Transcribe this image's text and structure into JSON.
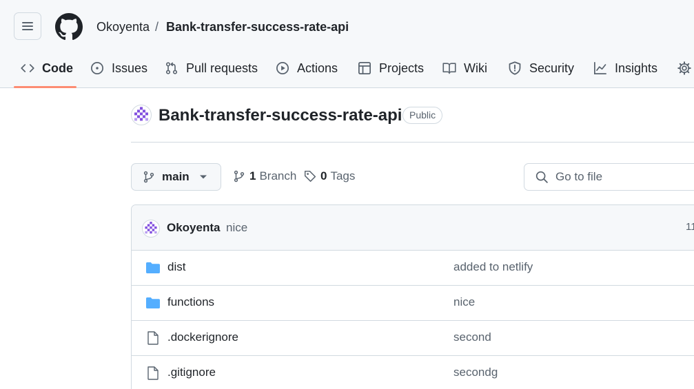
{
  "header": {
    "owner": "Okoyenta",
    "separator": "/",
    "repo": "Bank-transfer-success-rate-api"
  },
  "tabs": [
    {
      "label": "Code",
      "icon": "code-icon",
      "active": true
    },
    {
      "label": "Issues",
      "icon": "issue-icon"
    },
    {
      "label": "Pull requests",
      "icon": "pull-request-icon"
    },
    {
      "label": "Actions",
      "icon": "play-icon"
    },
    {
      "label": "Projects",
      "icon": "table-icon"
    },
    {
      "label": "Wiki",
      "icon": "book-icon"
    },
    {
      "label": "Security",
      "icon": "shield-icon"
    },
    {
      "label": "Insights",
      "icon": "graph-icon"
    },
    {
      "label": "",
      "icon": "gear-icon"
    }
  ],
  "repo": {
    "title": "Bank-transfer-success-rate-api",
    "visibility": "Public"
  },
  "toolbar": {
    "branch": "main",
    "branch_count": "1",
    "branch_label": "Branch",
    "tag_count": "0",
    "tag_label": "Tags",
    "goto_placeholder": "Go to file"
  },
  "commit": {
    "author": "Okoyenta",
    "message": "nice",
    "time": "11"
  },
  "files": [
    {
      "name": "dist",
      "type": "folder",
      "message": "added to netlify"
    },
    {
      "name": "functions",
      "type": "folder",
      "message": "nice"
    },
    {
      "name": ".dockerignore",
      "type": "file",
      "message": "second"
    },
    {
      "name": ".gitignore",
      "type": "file",
      "message": "secondg"
    }
  ],
  "colors": {
    "accent_underline": "#fd8c73",
    "folder": "#54aeff",
    "avatar": "#8250df"
  }
}
